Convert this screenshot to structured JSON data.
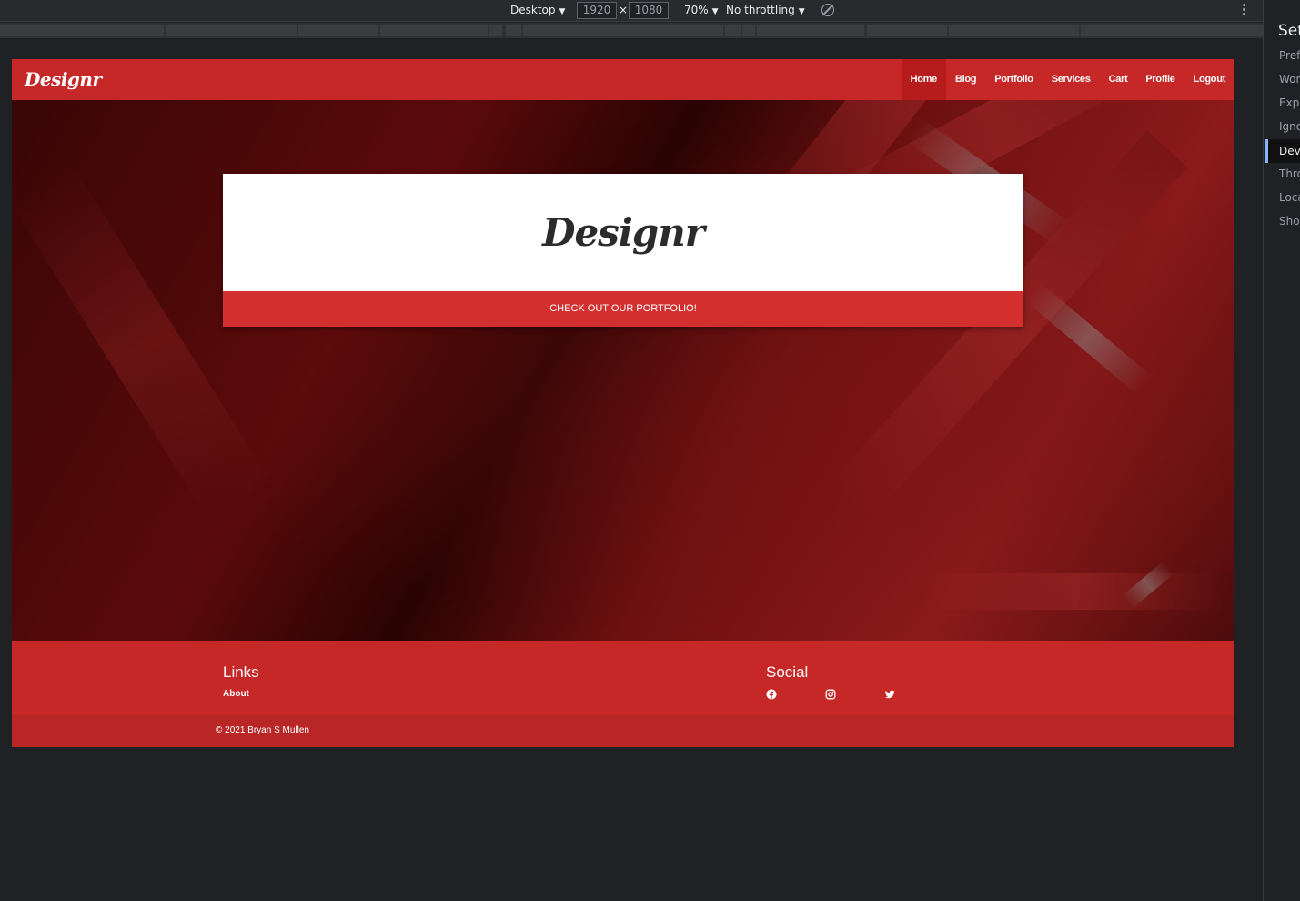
{
  "devtools": {
    "device": "Desktop",
    "width": "1920",
    "times": "×",
    "height": "1080",
    "zoom": "70%",
    "throttling": "No throttling",
    "caret": "▼"
  },
  "site": {
    "brand": "Designr",
    "nav": [
      {
        "label": "Home",
        "active": true
      },
      {
        "label": "Blog"
      },
      {
        "label": "Portfolio"
      },
      {
        "label": "Services"
      },
      {
        "label": "Cart"
      },
      {
        "label": "Profile"
      },
      {
        "label": "Logout"
      }
    ],
    "hero": {
      "title": "Designr",
      "cta": "CHECK OUT OUR PORTFOLIO!"
    },
    "footer": {
      "links_heading": "Links",
      "about_link": "About",
      "social_heading": "Social",
      "social_icons": [
        "facebook-icon",
        "instagram-icon",
        "twitter-icon"
      ],
      "copyright": "© 2021 Bryan S Mullen"
    },
    "colors": {
      "primary": "#c62828",
      "cta": "#d32f2f",
      "active_nav": "#b71c1c"
    }
  },
  "settings_panel": {
    "title": "Settings",
    "items": [
      {
        "label": "Preferences"
      },
      {
        "label": "Workspace"
      },
      {
        "label": "Experiments"
      },
      {
        "label": "Ignore List"
      },
      {
        "label": "Devices",
        "active": true
      },
      {
        "label": "Throttling"
      },
      {
        "label": "Locations"
      },
      {
        "label": "Shortcuts"
      }
    ]
  }
}
